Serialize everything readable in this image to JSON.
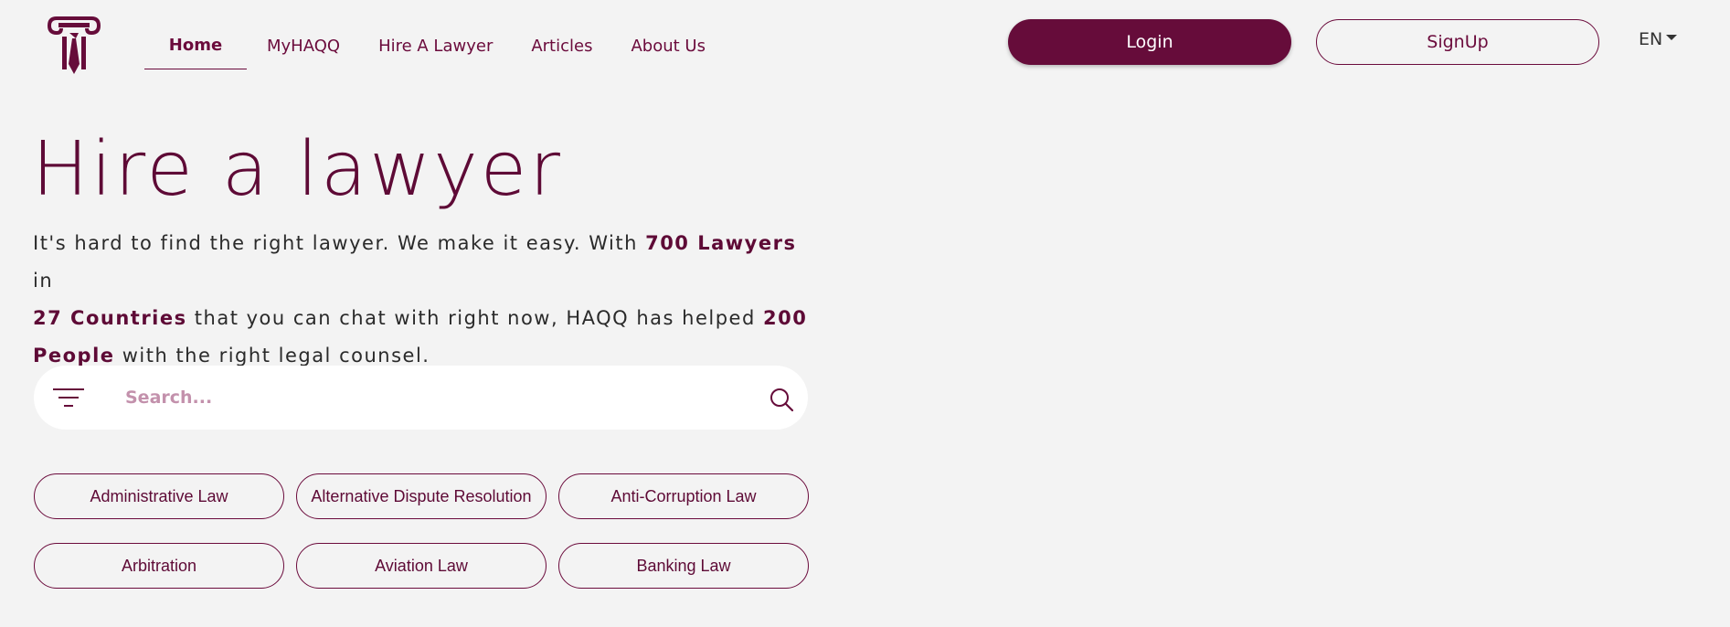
{
  "header": {
    "logo_icon": "pillar-tie-logo-icon",
    "nav": [
      {
        "label": "Home",
        "active": true
      },
      {
        "label": "MyHAQQ"
      },
      {
        "label": "Hire A Lawyer"
      },
      {
        "label": "Articles"
      },
      {
        "label": "About Us"
      }
    ],
    "login_label": "Login",
    "signup_label": "SignUp",
    "language": "EN"
  },
  "hero": {
    "title": "Hire a lawyer",
    "desc_1": "It's hard to find the right lawyer. We make it easy. With ",
    "lawyers": "700 Lawyers",
    "desc_2": " in ",
    "countries": "27 Countries",
    "desc_3": " that you can chat with right now, HAQQ has helped ",
    "people": "200 People",
    "desc_4": " with the right legal counsel."
  },
  "search": {
    "placeholder": "Search...",
    "value": "",
    "filter_icon": "filter-icon",
    "search_icon": "search-icon"
  },
  "categories": [
    "Administrative Law",
    "Alternative Dispute Resolution",
    "Anti-Corruption Law",
    "Arbitration",
    "Aviation Law",
    "Banking Law"
  ],
  "colors": {
    "brand": "#660c3a",
    "background": "#f3f3f3",
    "placeholder": "#c391ac"
  }
}
